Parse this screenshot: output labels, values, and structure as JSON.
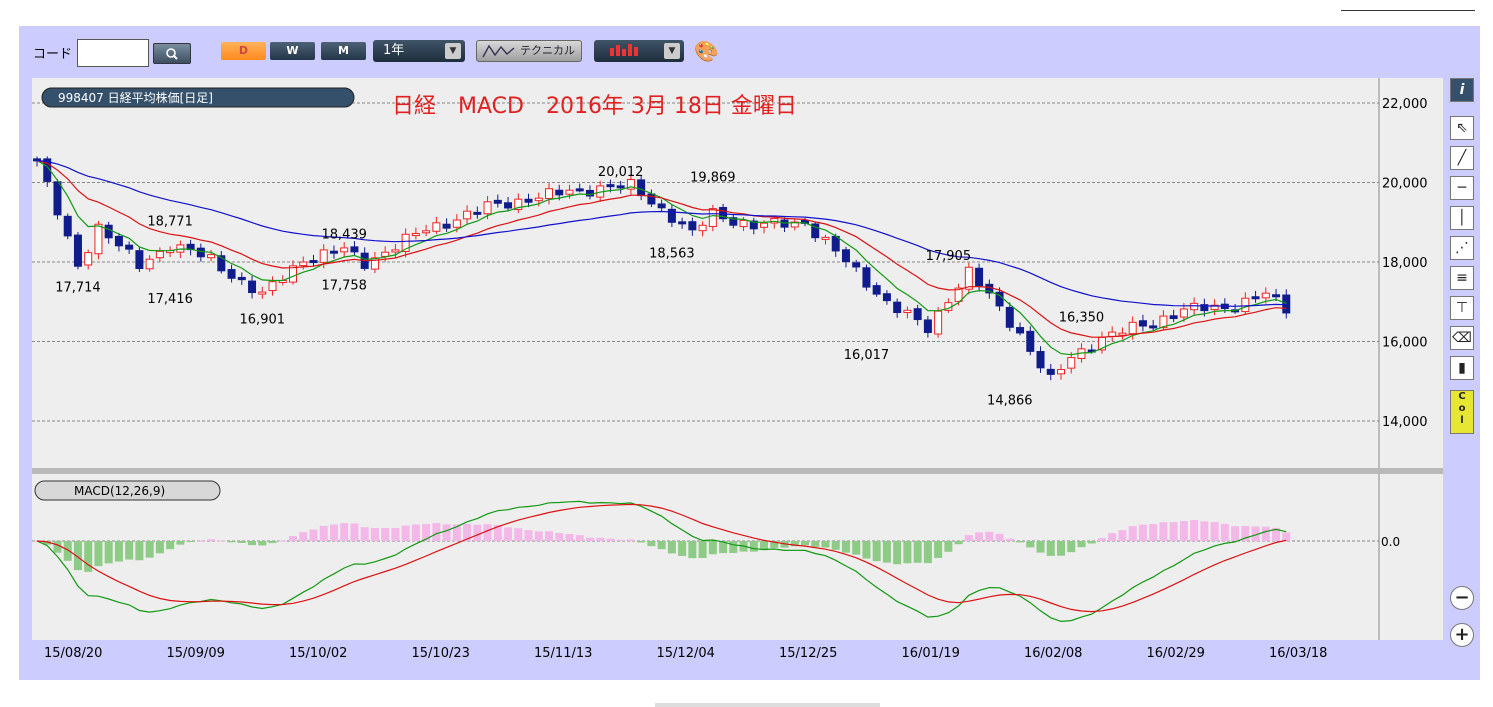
{
  "toolbar": {
    "code_label": "コード",
    "code_value": "",
    "period_d": "D",
    "period_w": "W",
    "period_m": "M",
    "range": "1年",
    "technical": "テクニカル"
  },
  "chart_data": {
    "type": "candlestick",
    "title": "日経　MACD　2016年 3月 18日 金曜日",
    "series_label": "998407 日経平均株価[日足]",
    "indicator_label": "MACD(12,26,9)",
    "y_ticks": [
      22000,
      20000,
      18000,
      16000,
      14000
    ],
    "y_tick_labels": [
      "22,000",
      "20,000",
      "18,000",
      "16,000",
      "14,000"
    ],
    "ylim": [
      12700,
      22700
    ],
    "macd_zero_label": "0.0",
    "x_labels": [
      "15/08/20",
      "15/09/09",
      "15/10/02",
      "15/10/23",
      "15/11/13",
      "15/12/04",
      "15/12/25",
      "16/01/19",
      "16/02/08",
      "16/02/29",
      "16/03/18"
    ],
    "annotations": [
      {
        "label": "17,714",
        "index": 4,
        "value": 17714
      },
      {
        "label": "18,771",
        "index": 13,
        "value": 18771
      },
      {
        "label": "17,416",
        "index": 13,
        "value": 17416
      },
      {
        "label": "16,901",
        "index": 22,
        "value": 16901
      },
      {
        "label": "18,439",
        "index": 30,
        "value": 18439
      },
      {
        "label": "17,758",
        "index": 30,
        "value": 17758
      },
      {
        "label": "20,012",
        "index": 57,
        "value": 20012
      },
      {
        "label": "19,869",
        "index": 66,
        "value": 19869
      },
      {
        "label": "18,563",
        "index": 62,
        "value": 18563
      },
      {
        "label": "17,905",
        "index": 89,
        "value": 17905
      },
      {
        "label": "16,017",
        "index": 81,
        "value": 16017
      },
      {
        "label": "14,866",
        "index": 95,
        "value": 14866
      },
      {
        "label": "16,350",
        "index": 102,
        "value": 16350
      }
    ],
    "close_anchors": [
      [
        0,
        20554
      ],
      [
        4,
        17900
      ],
      [
        6,
        18900
      ],
      [
        10,
        17900
      ],
      [
        13,
        18450
      ],
      [
        17,
        18050
      ],
      [
        22,
        17150
      ],
      [
        26,
        18080
      ],
      [
        30,
        18300
      ],
      [
        32,
        17980
      ],
      [
        38,
        18820
      ],
      [
        44,
        19380
      ],
      [
        48,
        19600
      ],
      [
        55,
        19880
      ],
      [
        58,
        19900
      ],
      [
        62,
        19150
      ],
      [
        64,
        18700
      ],
      [
        66,
        19230
      ],
      [
        70,
        18900
      ],
      [
        75,
        19010
      ],
      [
        79,
        18000
      ],
      [
        83,
        17000
      ],
      [
        87,
        16300
      ],
      [
        89,
        17100
      ],
      [
        91,
        17750
      ],
      [
        96,
        16200
      ],
      [
        99,
        15000
      ],
      [
        101,
        15600
      ],
      [
        104,
        16100
      ],
      [
        108,
        16400
      ],
      [
        112,
        16800
      ],
      [
        116,
        16850
      ],
      [
        120,
        17200
      ],
      [
        122,
        16800
      ]
    ]
  }
}
